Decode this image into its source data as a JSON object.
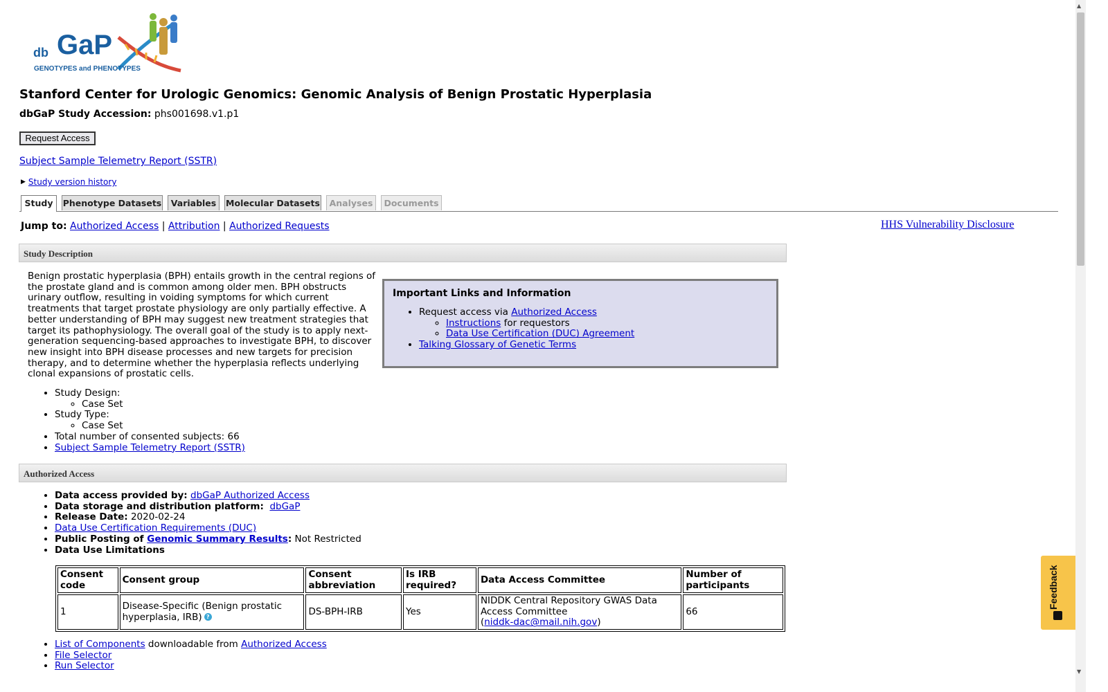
{
  "logo": {
    "db": "db",
    "gap": "GaP",
    "tagline": "GENOTYPES and PHENOTYPES"
  },
  "study": {
    "title": "Stanford Center for Urologic Genomics: Genomic Analysis of Benign Prostatic Hyperplasia",
    "accession_label": "dbGaP Study Accession:",
    "accession": "phs001698.v1.p1",
    "request_access": "Request Access",
    "sstr_link": "Subject Sample Telemetry Report (SSTR)",
    "version_history": "Study version history"
  },
  "tabs": [
    {
      "label": "Study",
      "state": "active"
    },
    {
      "label": "Phenotype Datasets",
      "state": "normal"
    },
    {
      "label": "Variables",
      "state": "normal"
    },
    {
      "label": "Molecular Datasets",
      "state": "normal"
    },
    {
      "label": "Analyses",
      "state": "disabled"
    },
    {
      "label": "Documents",
      "state": "disabled"
    }
  ],
  "jump_to": {
    "label": "Jump to:",
    "links": [
      "Authorized Access",
      "Attribution",
      "Authorized Requests"
    ],
    "sep": "|"
  },
  "hhs_link": "HHS Vulnerability Disclosure",
  "sections": {
    "description": "Study Description",
    "authorized_access": "Authorized Access"
  },
  "description": {
    "text": "Benign prostatic hyperplasia (BPH) entails growth in the central regions of the prostate gland and is common among older men. BPH obstructs urinary outflow, resulting in voiding symptoms for which current treatments that target prostate physiology are only partially effective. A better understanding of BPH may suggest new treatment strategies that target its pathophysiology. The overall goal of the study is to apply next-generation sequencing-based approaches to investigate BPH, to discover new insight into BPH disease processes and new targets for precision therapy, and to determine whether the hyperplasia reflects underlying clonal expansions of prostatic cells.",
    "design_label": "Study Design:",
    "design_value": "Case Set",
    "type_label": "Study Type:",
    "type_value": "Case Set",
    "subjects": "Total number of consented subjects: 66",
    "sstr_link": "Subject Sample Telemetry Report (SSTR)"
  },
  "links_box": {
    "title": "Important Links and Information",
    "request_prefix": "Request access via ",
    "request_link": "Authorized Access",
    "instructions_link": "Instructions",
    "instructions_suffix": " for requestors",
    "duc_link": "Data Use Certification (DUC) Agreement",
    "glossary_link": "Talking Glossary of Genetic Terms"
  },
  "access": {
    "provided_label": "Data access provided by:",
    "provided_link": "dbGaP Authorized Access",
    "platform_label": "Data storage and distribution platform:",
    "platform_link": "dbGaP",
    "release_label": "Release Date:",
    "release_value": "2020-02-24",
    "duc_link": "Data Use Certification Requirements (DUC)",
    "public_label": "Public Posting of",
    "gsr_link": "Genomic Summary Results",
    "public_value": "Not Restricted",
    "limitations_label": "Data Use Limitations"
  },
  "consent_table": {
    "headers": [
      "Consent code",
      "Consent group",
      "Consent abbreviation",
      "Is IRB required?",
      "Data Access Committee",
      "Number of participants"
    ],
    "rows": [
      {
        "code": "1",
        "group": "Disease-Specific (Benign prostatic hyperplasia, IRB)",
        "abbreviation": "DS-BPH-IRB",
        "irb": "Yes",
        "committee": "NIDDK Central Repository GWAS Data Access Committee",
        "committee_email": "niddk-dac@mail.nih.gov",
        "participants": "66"
      }
    ]
  },
  "bottom_links": {
    "components_link": "List of Components",
    "components_mid": " downloadable from ",
    "components_access": "Authorized Access",
    "file_selector": "File Selector",
    "run_selector": "Run Selector"
  },
  "feedback": {
    "label": "Feedback"
  },
  "colors": {
    "link": "#0000cc",
    "info_box_bg": "#dcdcee",
    "feedback_bg": "#f7c44a"
  }
}
